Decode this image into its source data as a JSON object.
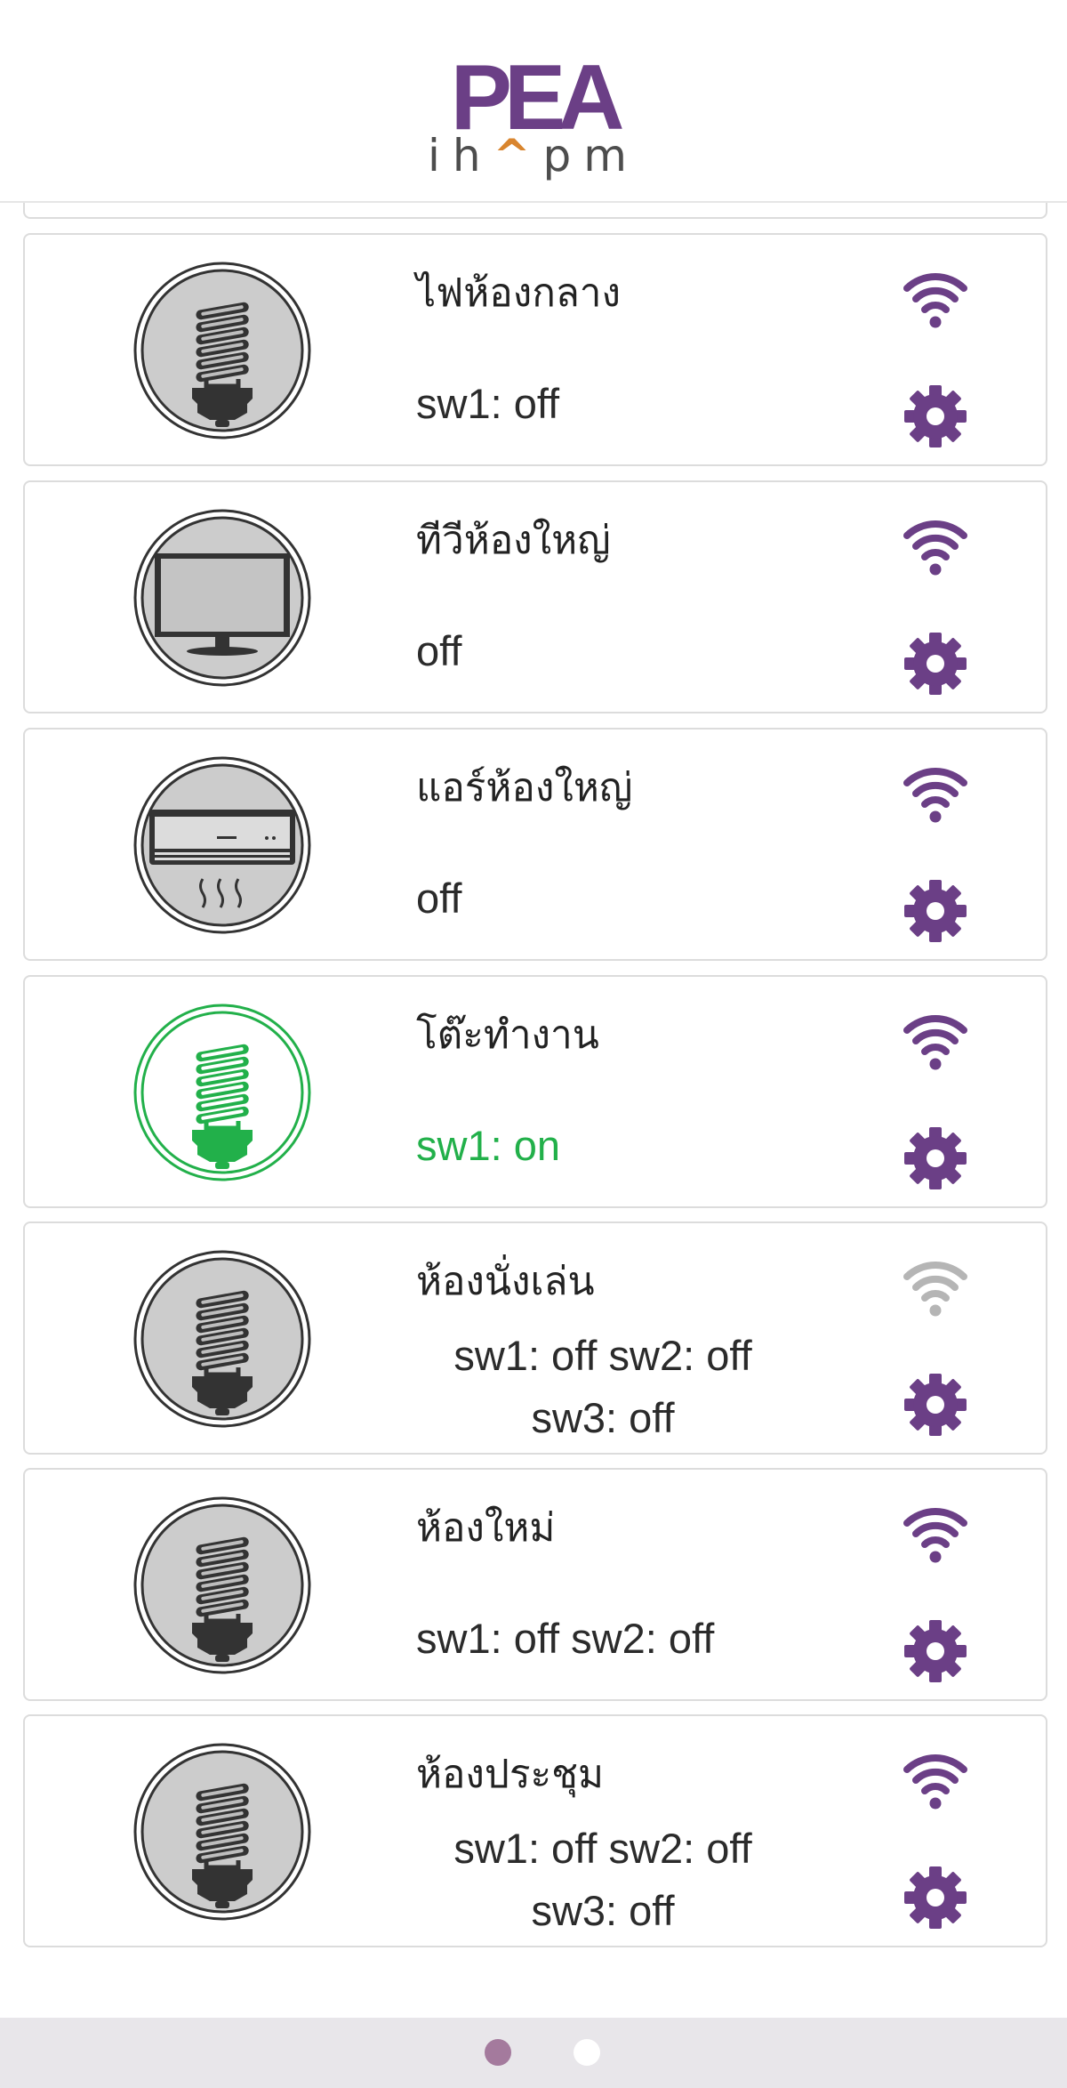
{
  "header": {
    "logo_main": "PEA",
    "logo_sub_pre": "ih",
    "logo_sub_hat": "^",
    "logo_sub_post": "pm"
  },
  "colors": {
    "accent": "#6b3f86",
    "on": "#22b04a",
    "off_icon_fill": "#cccccc",
    "wifi_offline": "#b5b5b5"
  },
  "devices": [
    {
      "name": "ไฟห้องกลาง",
      "status": "sw1: off",
      "icon": "bulb-icon",
      "state": "off",
      "wifi": "online"
    },
    {
      "name": "ทีวีห้องใหญ่",
      "status": "off",
      "icon": "tv-icon",
      "state": "off",
      "wifi": "online"
    },
    {
      "name": "แอร์ห้องใหญ่",
      "status": "off",
      "icon": "air-conditioner-icon",
      "state": "off",
      "wifi": "online"
    },
    {
      "name": "โต๊ะทำงาน",
      "status": "sw1: on",
      "icon": "bulb-icon",
      "state": "on",
      "wifi": "online"
    },
    {
      "name": "ห้องนั่งเล่น",
      "status": "sw1: off sw2: off sw3: off",
      "icon": "bulb-icon",
      "state": "off",
      "wifi": "offline"
    },
    {
      "name": "ห้องใหม่",
      "status": "sw1: off sw2: off",
      "icon": "bulb-icon",
      "state": "off",
      "wifi": "online"
    },
    {
      "name": "ห้องประชุม",
      "status": "sw1: off sw2: off sw3: off",
      "icon": "bulb-icon",
      "state": "off",
      "wifi": "online"
    }
  ],
  "pager": {
    "page_count": 2,
    "active_page": 1
  }
}
